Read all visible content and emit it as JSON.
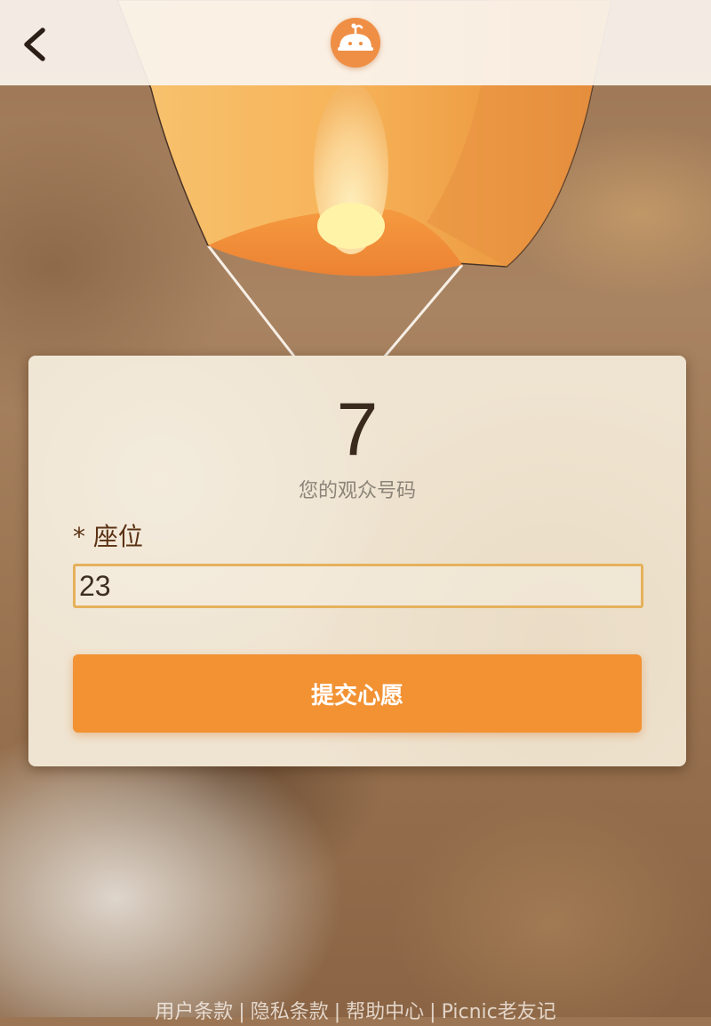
{
  "header": {
    "back_icon": "chevron-left-icon",
    "logo_icon": "lantern-mascot-icon"
  },
  "card": {
    "number": "7",
    "number_caption": "您的观众号码",
    "field_label": "* 座位",
    "seat_value": "23",
    "submit_label": "提交心愿"
  },
  "footer": {
    "links": [
      "用户条款",
      "隐私条款",
      "帮助中心",
      "Picnic老友记"
    ],
    "separator": "|"
  },
  "colors": {
    "accent": "#f29233",
    "label": "#5b3213",
    "input_border": "#e6b15c",
    "logo": "#ef8f45"
  }
}
